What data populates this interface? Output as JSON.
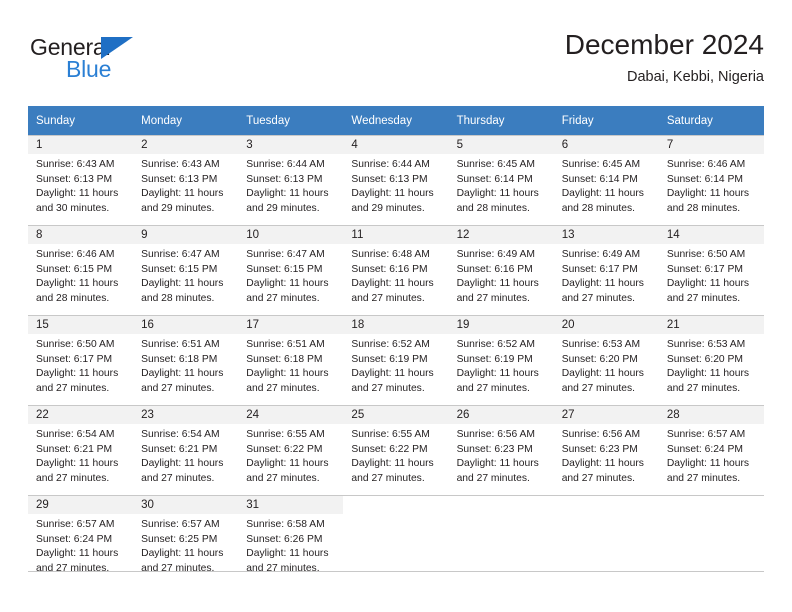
{
  "logo": {
    "word_top": "General",
    "word_bottom": "Blue",
    "triangle_color": "#1f6fc4",
    "blue_text_color": "#2a7fd4"
  },
  "header": {
    "title": "December 2024",
    "subtitle": "Dabai, Kebbi, Nigeria"
  },
  "theme": {
    "header_row_bg": "#3b7dbf",
    "header_row_text": "#ffffff",
    "daynum_band_bg": "#f2f2f2",
    "grid_line": "#c8c8c8",
    "text": "#231f20"
  },
  "weekday_headers": [
    "Sunday",
    "Monday",
    "Tuesday",
    "Wednesday",
    "Thursday",
    "Friday",
    "Saturday"
  ],
  "labels": {
    "sunrise_prefix": "Sunrise:",
    "sunset_prefix": "Sunset:",
    "daylight_prefix": "Daylight:"
  },
  "weeks": [
    [
      {
        "day": "1",
        "line1": "Sunrise: 6:43 AM",
        "line2": "Sunset: 6:13 PM",
        "line3": "Daylight: 11 hours",
        "line4": "and 30 minutes."
      },
      {
        "day": "2",
        "line1": "Sunrise: 6:43 AM",
        "line2": "Sunset: 6:13 PM",
        "line3": "Daylight: 11 hours",
        "line4": "and 29 minutes."
      },
      {
        "day": "3",
        "line1": "Sunrise: 6:44 AM",
        "line2": "Sunset: 6:13 PM",
        "line3": "Daylight: 11 hours",
        "line4": "and 29 minutes."
      },
      {
        "day": "4",
        "line1": "Sunrise: 6:44 AM",
        "line2": "Sunset: 6:13 PM",
        "line3": "Daylight: 11 hours",
        "line4": "and 29 minutes."
      },
      {
        "day": "5",
        "line1": "Sunrise: 6:45 AM",
        "line2": "Sunset: 6:14 PM",
        "line3": "Daylight: 11 hours",
        "line4": "and 28 minutes."
      },
      {
        "day": "6",
        "line1": "Sunrise: 6:45 AM",
        "line2": "Sunset: 6:14 PM",
        "line3": "Daylight: 11 hours",
        "line4": "and 28 minutes."
      },
      {
        "day": "7",
        "line1": "Sunrise: 6:46 AM",
        "line2": "Sunset: 6:14 PM",
        "line3": "Daylight: 11 hours",
        "line4": "and 28 minutes."
      }
    ],
    [
      {
        "day": "8",
        "line1": "Sunrise: 6:46 AM",
        "line2": "Sunset: 6:15 PM",
        "line3": "Daylight: 11 hours",
        "line4": "and 28 minutes."
      },
      {
        "day": "9",
        "line1": "Sunrise: 6:47 AM",
        "line2": "Sunset: 6:15 PM",
        "line3": "Daylight: 11 hours",
        "line4": "and 28 minutes."
      },
      {
        "day": "10",
        "line1": "Sunrise: 6:47 AM",
        "line2": "Sunset: 6:15 PM",
        "line3": "Daylight: 11 hours",
        "line4": "and 27 minutes."
      },
      {
        "day": "11",
        "line1": "Sunrise: 6:48 AM",
        "line2": "Sunset: 6:16 PM",
        "line3": "Daylight: 11 hours",
        "line4": "and 27 minutes."
      },
      {
        "day": "12",
        "line1": "Sunrise: 6:49 AM",
        "line2": "Sunset: 6:16 PM",
        "line3": "Daylight: 11 hours",
        "line4": "and 27 minutes."
      },
      {
        "day": "13",
        "line1": "Sunrise: 6:49 AM",
        "line2": "Sunset: 6:17 PM",
        "line3": "Daylight: 11 hours",
        "line4": "and 27 minutes."
      },
      {
        "day": "14",
        "line1": "Sunrise: 6:50 AM",
        "line2": "Sunset: 6:17 PM",
        "line3": "Daylight: 11 hours",
        "line4": "and 27 minutes."
      }
    ],
    [
      {
        "day": "15",
        "line1": "Sunrise: 6:50 AM",
        "line2": "Sunset: 6:17 PM",
        "line3": "Daylight: 11 hours",
        "line4": "and 27 minutes."
      },
      {
        "day": "16",
        "line1": "Sunrise: 6:51 AM",
        "line2": "Sunset: 6:18 PM",
        "line3": "Daylight: 11 hours",
        "line4": "and 27 minutes."
      },
      {
        "day": "17",
        "line1": "Sunrise: 6:51 AM",
        "line2": "Sunset: 6:18 PM",
        "line3": "Daylight: 11 hours",
        "line4": "and 27 minutes."
      },
      {
        "day": "18",
        "line1": "Sunrise: 6:52 AM",
        "line2": "Sunset: 6:19 PM",
        "line3": "Daylight: 11 hours",
        "line4": "and 27 minutes."
      },
      {
        "day": "19",
        "line1": "Sunrise: 6:52 AM",
        "line2": "Sunset: 6:19 PM",
        "line3": "Daylight: 11 hours",
        "line4": "and 27 minutes."
      },
      {
        "day": "20",
        "line1": "Sunrise: 6:53 AM",
        "line2": "Sunset: 6:20 PM",
        "line3": "Daylight: 11 hours",
        "line4": "and 27 minutes."
      },
      {
        "day": "21",
        "line1": "Sunrise: 6:53 AM",
        "line2": "Sunset: 6:20 PM",
        "line3": "Daylight: 11 hours",
        "line4": "and 27 minutes."
      }
    ],
    [
      {
        "day": "22",
        "line1": "Sunrise: 6:54 AM",
        "line2": "Sunset: 6:21 PM",
        "line3": "Daylight: 11 hours",
        "line4": "and 27 minutes."
      },
      {
        "day": "23",
        "line1": "Sunrise: 6:54 AM",
        "line2": "Sunset: 6:21 PM",
        "line3": "Daylight: 11 hours",
        "line4": "and 27 minutes."
      },
      {
        "day": "24",
        "line1": "Sunrise: 6:55 AM",
        "line2": "Sunset: 6:22 PM",
        "line3": "Daylight: 11 hours",
        "line4": "and 27 minutes."
      },
      {
        "day": "25",
        "line1": "Sunrise: 6:55 AM",
        "line2": "Sunset: 6:22 PM",
        "line3": "Daylight: 11 hours",
        "line4": "and 27 minutes."
      },
      {
        "day": "26",
        "line1": "Sunrise: 6:56 AM",
        "line2": "Sunset: 6:23 PM",
        "line3": "Daylight: 11 hours",
        "line4": "and 27 minutes."
      },
      {
        "day": "27",
        "line1": "Sunrise: 6:56 AM",
        "line2": "Sunset: 6:23 PM",
        "line3": "Daylight: 11 hours",
        "line4": "and 27 minutes."
      },
      {
        "day": "28",
        "line1": "Sunrise: 6:57 AM",
        "line2": "Sunset: 6:24 PM",
        "line3": "Daylight: 11 hours",
        "line4": "and 27 minutes."
      }
    ],
    [
      {
        "day": "29",
        "line1": "Sunrise: 6:57 AM",
        "line2": "Sunset: 6:24 PM",
        "line3": "Daylight: 11 hours",
        "line4": "and 27 minutes."
      },
      {
        "day": "30",
        "line1": "Sunrise: 6:57 AM",
        "line2": "Sunset: 6:25 PM",
        "line3": "Daylight: 11 hours",
        "line4": "and 27 minutes."
      },
      {
        "day": "31",
        "line1": "Sunrise: 6:58 AM",
        "line2": "Sunset: 6:26 PM",
        "line3": "Daylight: 11 hours",
        "line4": "and 27 minutes."
      },
      {
        "day": "",
        "line1": "",
        "line2": "",
        "line3": "",
        "line4": ""
      },
      {
        "day": "",
        "line1": "",
        "line2": "",
        "line3": "",
        "line4": ""
      },
      {
        "day": "",
        "line1": "",
        "line2": "",
        "line3": "",
        "line4": ""
      },
      {
        "day": "",
        "line1": "",
        "line2": "",
        "line3": "",
        "line4": ""
      }
    ]
  ]
}
